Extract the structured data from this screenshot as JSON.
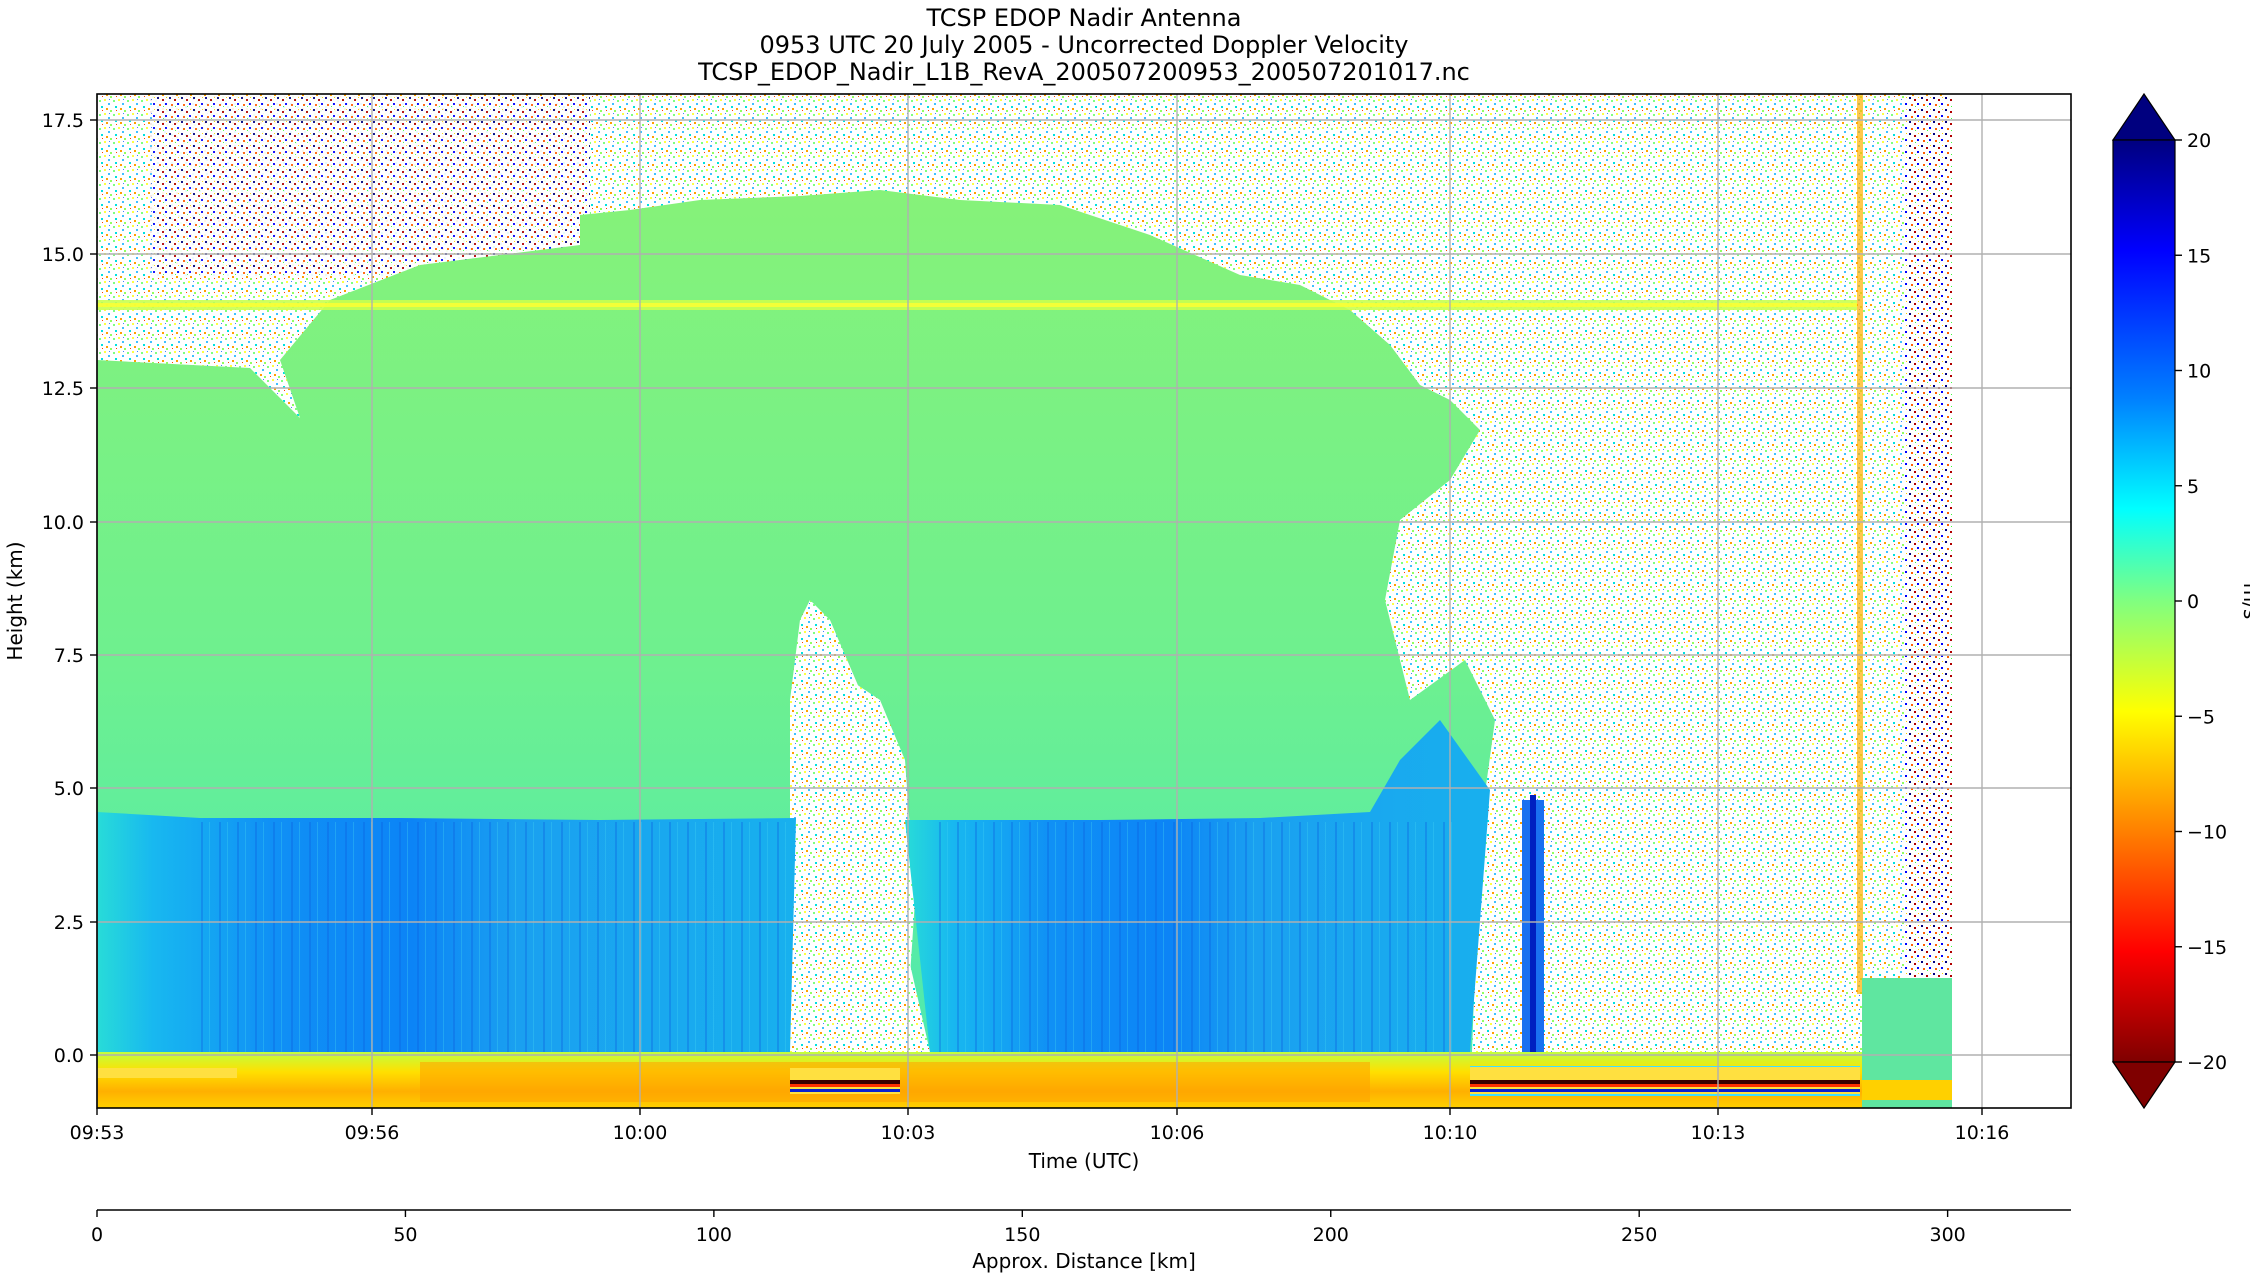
{
  "chart_data": {
    "type": "heatmap",
    "title_lines": [
      "TCSP EDOP Nadir Antenna",
      "0953 UTC 20 July 2005 - Uncorrected Doppler Velocity",
      "TCSP_EDOP_Nadir_L1B_RevA_200507200953_200507201017.nc"
    ],
    "xlabel": "Time (UTC)",
    "ylabel": "Height (km)",
    "x2label": "Approx. Distance [km]",
    "colorbar_label": "m/s",
    "x_ticks": [
      "09:53",
      "09:56",
      "10:00",
      "10:03",
      "10:06",
      "10:10",
      "10:13",
      "10:16"
    ],
    "y_ticks": [
      "0.0",
      "2.5",
      "5.0",
      "7.5",
      "10.0",
      "12.5",
      "15.0",
      "17.5"
    ],
    "y_range": [
      -1.0,
      18.0
    ],
    "distance_ticks": [
      "0",
      "50",
      "100",
      "150",
      "200",
      "250",
      "300"
    ],
    "distance_range": [
      0,
      320
    ],
    "colorbar_ticks": [
      "20",
      "15",
      "10",
      "5",
      "0",
      "−5",
      "−10",
      "−15",
      "−20"
    ],
    "colorbar_range": [
      -20,
      20
    ],
    "colormap": [
      "#7f0000",
      "#ff0000",
      "#ff8000",
      "#ffff00",
      "#80ff80",
      "#00ffff",
      "#0080ff",
      "#0000ff",
      "#00007f"
    ],
    "grid": true,
    "features": {
      "melting_level_km": 4.4,
      "noise_band_km": 14.0
    }
  }
}
